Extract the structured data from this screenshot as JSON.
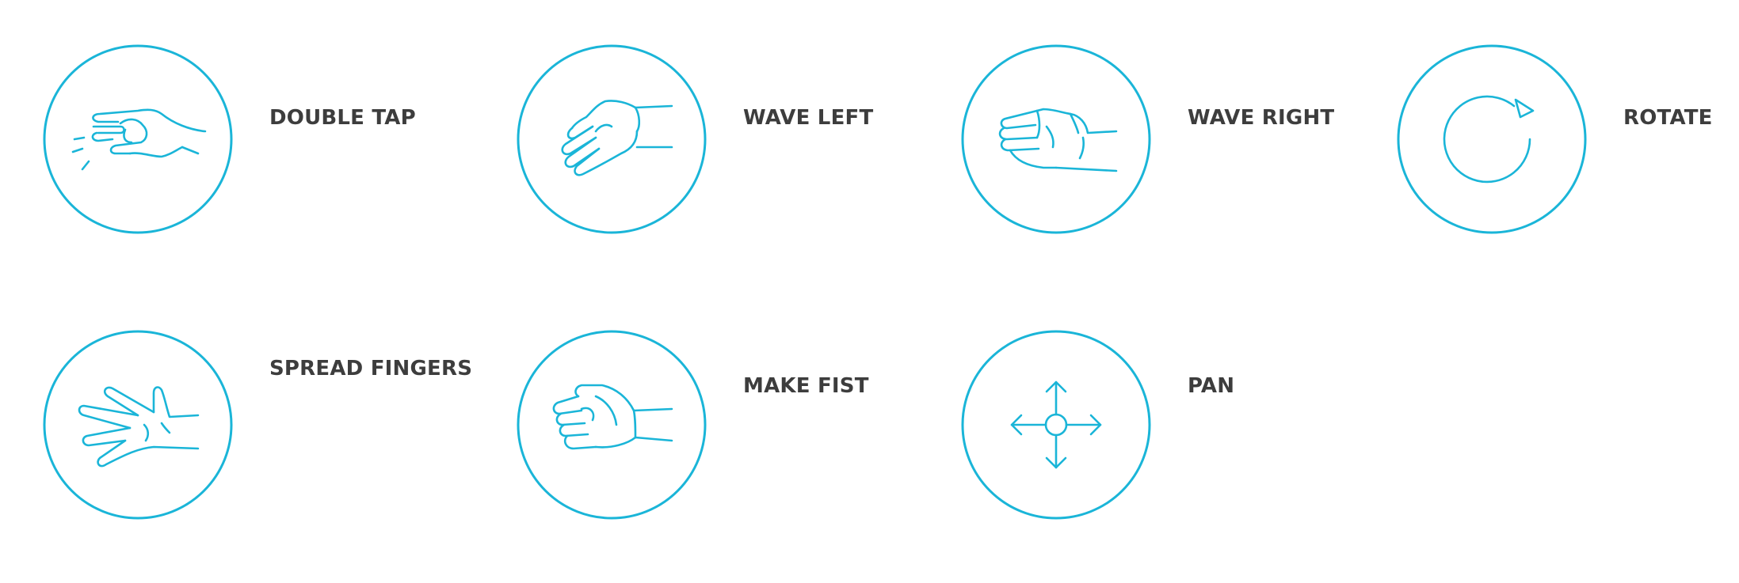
{
  "accent_color": "#1ab5d8",
  "text_color": "#3d3d3d",
  "gestures": [
    {
      "label": "DOUBLE TAP",
      "icon": "double-tap-hand-icon"
    },
    {
      "label": "WAVE LEFT",
      "icon": "wave-left-hand-icon"
    },
    {
      "label": "WAVE RIGHT",
      "icon": "wave-right-hand-icon"
    },
    {
      "label": "ROTATE",
      "icon": "rotate-arrow-icon"
    },
    {
      "label": "SPREAD FINGERS",
      "icon": "spread-fingers-hand-icon"
    },
    {
      "label": "MAKE FIST",
      "icon": "fist-hand-icon"
    },
    {
      "label": "PAN",
      "icon": "pan-arrows-icon"
    }
  ]
}
